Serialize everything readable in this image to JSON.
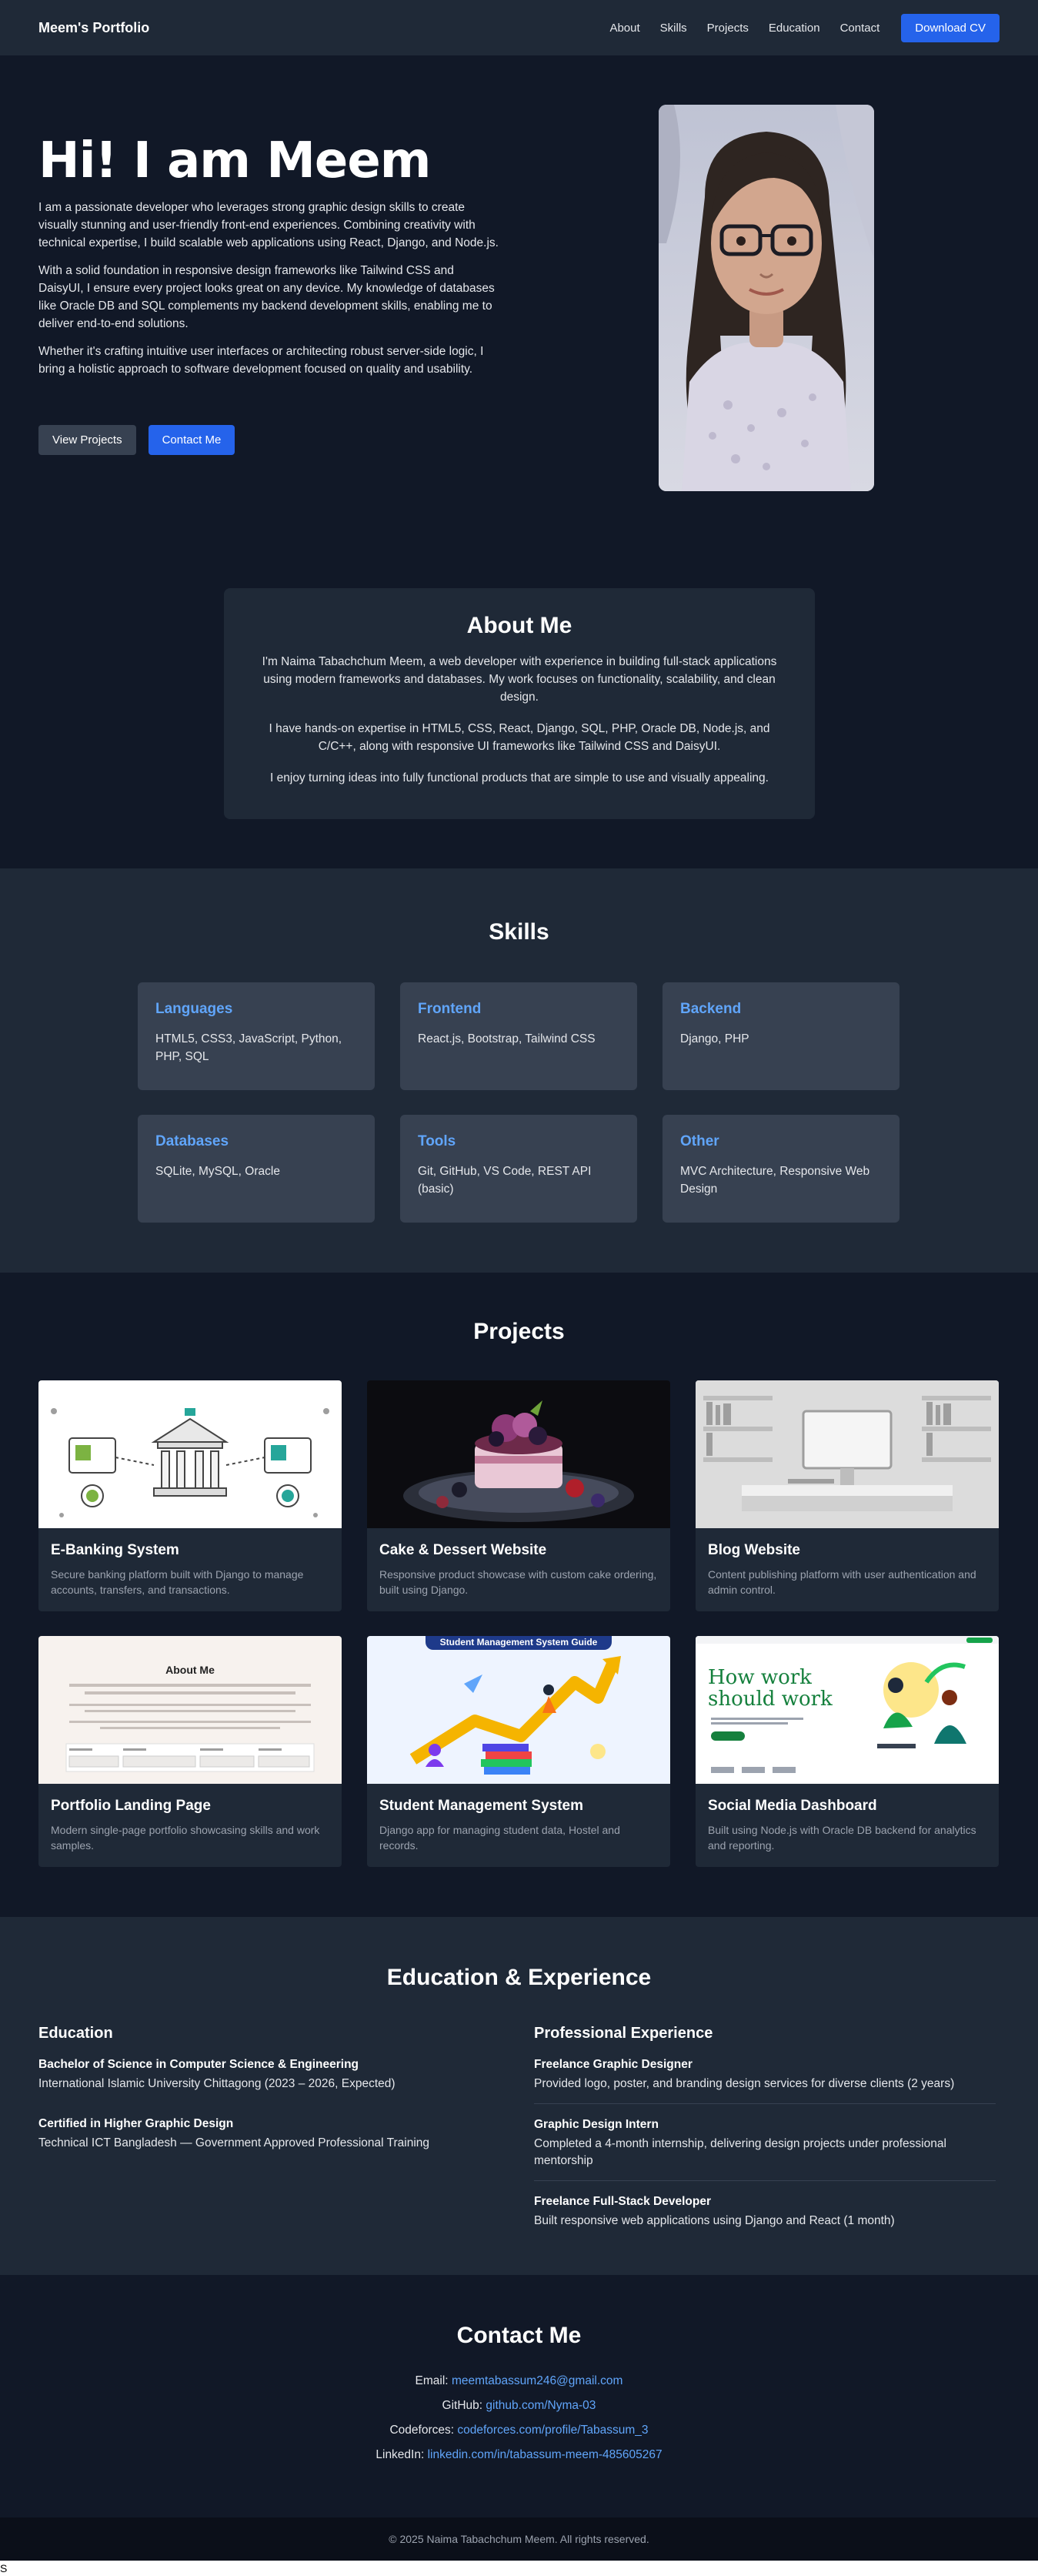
{
  "nav": {
    "brand": "Meem's Portfolio",
    "links": [
      "About",
      "Skills",
      "Projects",
      "Education",
      "Contact"
    ],
    "cv_button": "Download CV"
  },
  "hero": {
    "title": "Hi! I am Meem",
    "paragraphs": [
      "I am a passionate developer who leverages strong graphic design skills to create visually stunning and user-friendly front-end experiences. Combining creativity with technical expertise, I build scalable web applications using React, Django, and Node.js.",
      "With a solid foundation in responsive design frameworks like Tailwind CSS and DaisyUI, I ensure every project looks great on any device. My knowledge of databases like Oracle DB and SQL complements my backend development skills, enabling me to deliver end-to-end solutions.",
      "Whether it's crafting intuitive user interfaces or architecting robust server-side logic, I bring a holistic approach to software development focused on quality and usability."
    ],
    "view_projects": "View Projects",
    "contact_me": "Contact Me"
  },
  "about": {
    "title": "About Me",
    "paragraphs": [
      "I'm Naima Tabachchum Meem, a web developer with experience in building full-stack applications using modern frameworks and databases. My work focuses on functionality, scalability, and clean design.",
      "I have hands-on expertise in HTML5, CSS, React, Django, SQL, PHP, Oracle DB, Node.js, and C/C++, along with responsive UI frameworks like Tailwind CSS and DaisyUI.",
      "I enjoy turning ideas into fully functional products that are simple to use and visually appealing."
    ]
  },
  "skills": {
    "title": "Skills",
    "items": [
      {
        "head": "Languages",
        "body": "HTML5, CSS3, JavaScript, Python, PHP, SQL"
      },
      {
        "head": "Frontend",
        "body": "React.js, Bootstrap, Tailwind CSS"
      },
      {
        "head": "Backend",
        "body": "Django, PHP"
      },
      {
        "head": "Databases",
        "body": "SQLite, MySQL, Oracle"
      },
      {
        "head": "Tools",
        "body": "Git, GitHub, VS Code, REST API (basic)"
      },
      {
        "head": "Other",
        "body": "MVC Architecture, Responsive Web Design"
      }
    ]
  },
  "projects": {
    "title": "Projects",
    "items": [
      {
        "title": "E-Banking System",
        "desc": "Secure banking platform built with Django to manage accounts, transfers, and transactions."
      },
      {
        "title": "Cake & Dessert Website",
        "desc": "Responsive product showcase with custom cake ordering, built using Django."
      },
      {
        "title": "Blog Website",
        "desc": "Content publishing platform with user authentication and admin control."
      },
      {
        "title": "Portfolio Landing Page",
        "desc": "Modern single-page portfolio showcasing skills and work samples."
      },
      {
        "title": "Student Management System",
        "desc": "Django app for managing student data, Hostel and records."
      },
      {
        "title": "Social Media Dashboard",
        "desc": "Built using Node.js with Oracle DB backend for analytics and reporting."
      }
    ],
    "thumb_text": {
      "about_title": "About Me",
      "sms_banner": "Student Management System Guide",
      "hw_line1": "How work",
      "hw_line2": "should work"
    }
  },
  "education": {
    "title": "Education & Experience",
    "edu_head": "Education",
    "exp_head": "Professional Experience",
    "edu": [
      {
        "title": "Bachelor of Science in Computer Science & Engineering",
        "text": "International Islamic University Chittagong (2023 – 2026, Expected)"
      },
      {
        "title": "Certified in Higher Graphic Design",
        "text": "Technical ICT Bangladesh — Government Approved Professional Training"
      }
    ],
    "exp": [
      {
        "title": "Freelance Graphic Designer",
        "text": "Provided logo, poster, and branding design services for diverse clients (2 years)"
      },
      {
        "title": "Graphic Design Intern",
        "text": "Completed a 4-month internship, delivering design projects under professional mentorship"
      },
      {
        "title": "Freelance Full-Stack Developer",
        "text": "Built responsive web applications using Django and React (1 month)"
      }
    ]
  },
  "contact": {
    "title": "Contact Me",
    "lines": [
      {
        "label": "Email:",
        "value": "meemtabassum246@gmail.com"
      },
      {
        "label": "GitHub:",
        "value": "github.com/Nyma-03"
      },
      {
        "label": "Codeforces:",
        "value": "codeforces.com/profile/Tabassum_3"
      },
      {
        "label": "LinkedIn:",
        "value": "linkedin.com/in/tabassum-meem-485605267"
      }
    ]
  },
  "footer": {
    "text": "© 2025 Naima Tabachchum Meem. All rights reserved.",
    "stray": "S"
  },
  "colors": {
    "bg": "#111827",
    "surface": "#1f2937",
    "card": "#374151",
    "accent": "#2563eb",
    "link": "#60a5fa"
  }
}
